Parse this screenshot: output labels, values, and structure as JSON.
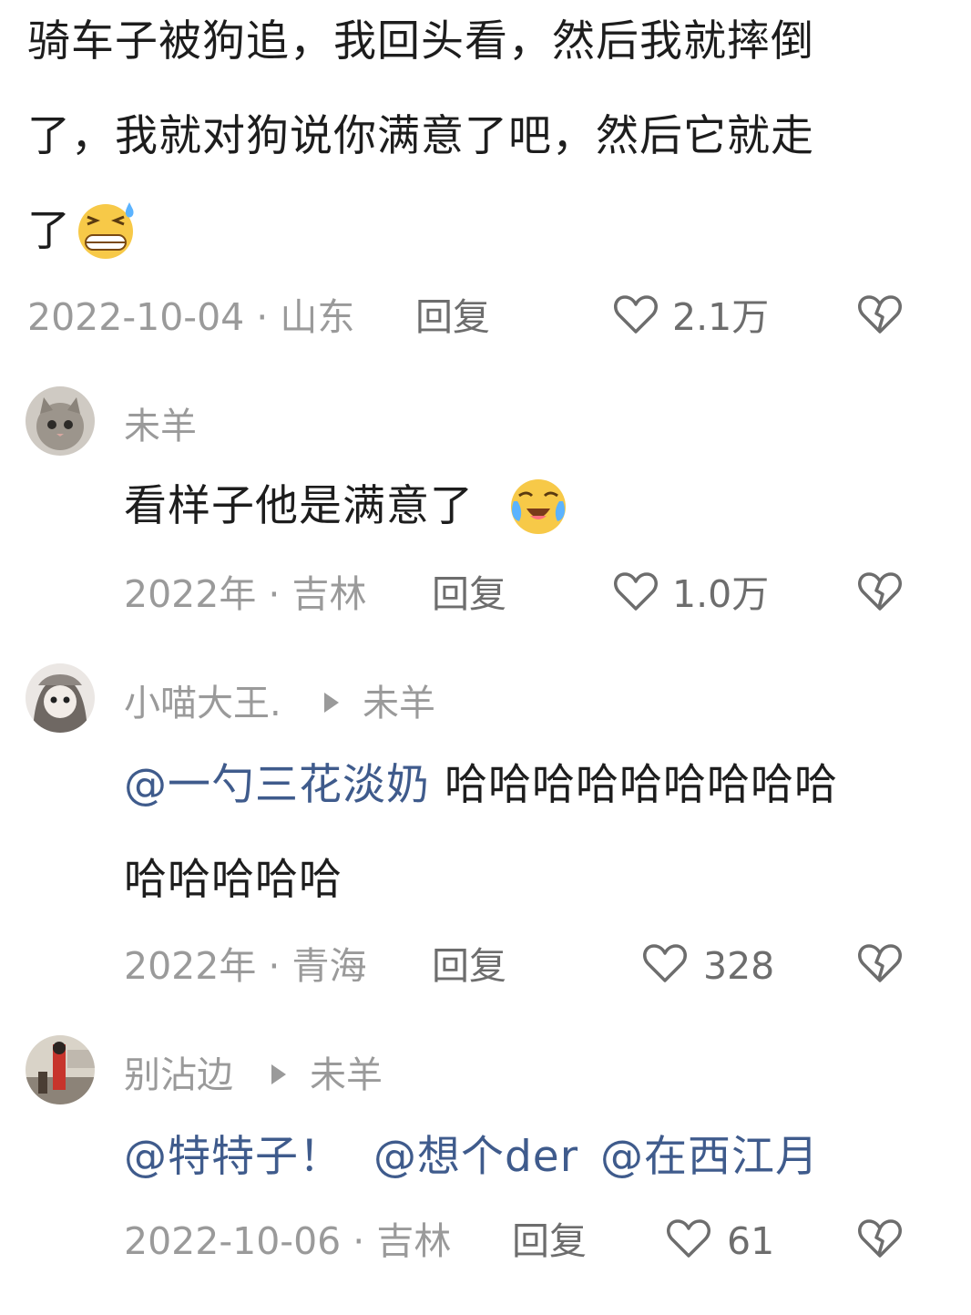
{
  "main_comment": {
    "lines": [
      "骑车子被狗追，我回头看，然后我就摔倒",
      "了，我就对狗说你满意了吧，然后它就走",
      "了"
    ],
    "emoji": "grin-sweat-emoji",
    "meta": "2022-10-04 · 山东",
    "reply_label": "回复",
    "like_count": "2.1万"
  },
  "replies": [
    {
      "username": "未羊",
      "lines": [
        "看样子他是满意了"
      ],
      "emoji": "crying-laughing-emoji",
      "meta": "2022年 · 吉林",
      "reply_label": "回复",
      "like_count": "1.0万"
    },
    {
      "username": "小喵大王.",
      "reply_to": "未羊",
      "mention": "@一勺三花淡奶",
      "line1_rest": "哈哈哈哈哈哈哈哈哈",
      "line2": "哈哈哈哈哈",
      "meta": "2022年 · 青海",
      "reply_label": "回复",
      "like_count": "328"
    },
    {
      "username": "别沾边",
      "reply_to": "未羊",
      "mention1": "@特特子！",
      "mention2": "@想个der",
      "mention3": "@在西江月",
      "meta": "2022-10-06 · 吉林",
      "reply_label": "回复",
      "like_count": "61"
    }
  ],
  "colors": {
    "text": "#1d1d1d",
    "meta": "#9a9a9a",
    "mention": "#3f5b8c",
    "icon": "#6d6d6d"
  }
}
